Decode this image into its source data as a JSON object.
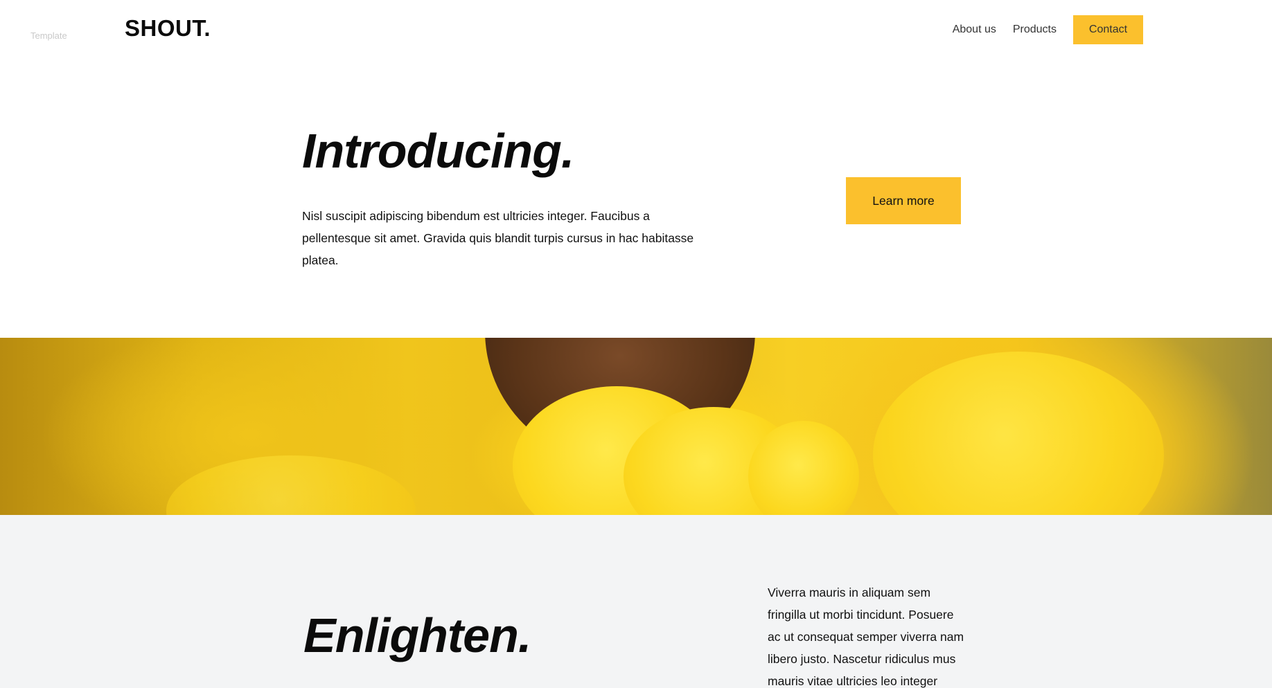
{
  "header": {
    "template_tag": "Template",
    "logo": "SHOUT.",
    "nav": {
      "about": "About us",
      "products": "Products",
      "contact": "Contact"
    }
  },
  "hero": {
    "title": "Introducing.",
    "text": "Nisl suscipit adipiscing bibendum est ultricies integer. Faucibus a pellentesque sit amet. Gravida quis blandit turpis cursus in hac habitasse platea.",
    "cta": "Learn more"
  },
  "banner": {
    "image": "yellow-smoke-photo"
  },
  "section2": {
    "title": "Enlighten.",
    "text": "Viverra mauris in aliquam sem fringilla ut morbi tincidunt. Posuere ac ut consequat semper viverra nam libero justo. Nascetur ridiculus mus mauris vitae ultricies leo integer"
  },
  "colors": {
    "accent": "#fbc02d",
    "section_bg": "#f3f4f5"
  }
}
